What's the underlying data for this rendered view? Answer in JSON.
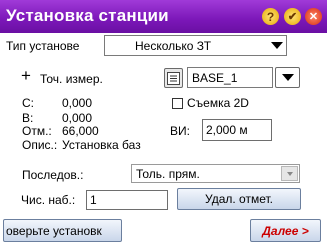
{
  "window": {
    "title": "Установка станции"
  },
  "setup_type": {
    "label": "Тип установе",
    "value": "Несколько ЗТ"
  },
  "meas_point": {
    "label": "Точ. измер.",
    "value": "BASE_1"
  },
  "coords": {
    "c_label": "С:",
    "c_value": "0,000",
    "b_label": "В:",
    "b_value": "0,000",
    "h_label": "Отм.:",
    "h_value": "66,000",
    "desc_label": "Опис.:",
    "desc_value": "Установка баз"
  },
  "survey2d": {
    "label": "Съемка 2D",
    "checked": false
  },
  "vi": {
    "label": "ВИ:",
    "value": "2,000 м"
  },
  "sequence": {
    "label": "Последов.:",
    "value": "Толь. прям."
  },
  "obs_count": {
    "label": "Чис. наб.:",
    "value": "1"
  },
  "buttons": {
    "delete_mark": "Удал. отмет.",
    "check_setup": "оверьте установк",
    "next": "Далее >"
  },
  "colors": {
    "titlebar": "#7b17b8",
    "next_text": "#cc0000"
  }
}
